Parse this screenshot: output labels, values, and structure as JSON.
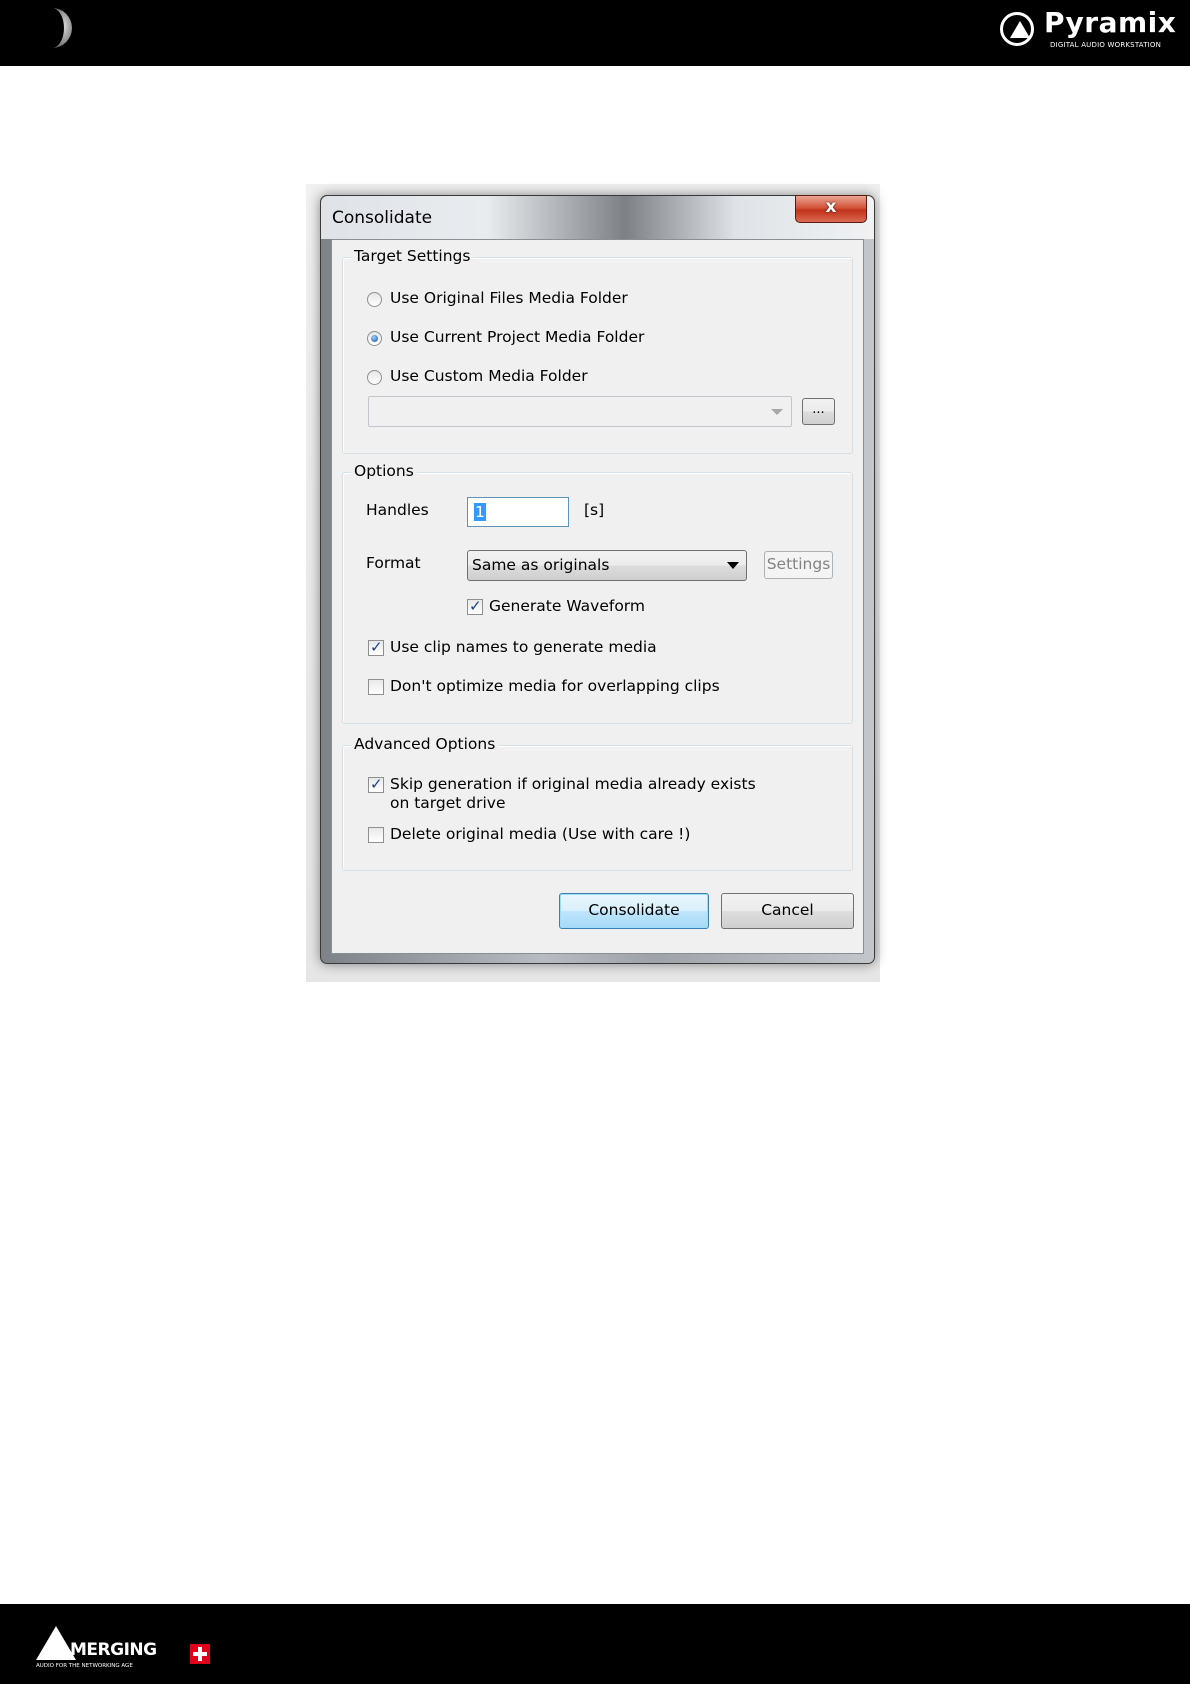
{
  "header": {
    "brand_name": "Pyramix",
    "brand_subtitle": "DIGITAL AUDIO WORKSTATION"
  },
  "footer": {
    "brand_name": "MERGING",
    "brand_subtitle": "AUDIO FOR THE NETWORKING AGE"
  },
  "dialog": {
    "title": "Consolidate",
    "close_label": "x",
    "target_settings": {
      "legend": "Target Settings",
      "options": [
        {
          "label": "Use Original Files Media Folder",
          "selected": false
        },
        {
          "label": "Use Current Project Media Folder",
          "selected": true
        },
        {
          "label": "Use Custom Media Folder",
          "selected": false
        }
      ],
      "custom_folder_value": "",
      "browse_label": "..."
    },
    "options": {
      "legend": "Options",
      "handles_label": "Handles",
      "handles_value": "1",
      "handles_unit": "[s]",
      "format_label": "Format",
      "format_value": "Same as originals",
      "settings_label": "Settings",
      "generate_waveform_label": "Generate Waveform",
      "generate_waveform_checked": true,
      "use_clip_names_label": "Use clip names to generate media",
      "use_clip_names_checked": true,
      "dont_optimize_label": "Don't optimize media for overlapping clips",
      "dont_optimize_checked": false
    },
    "advanced": {
      "legend": "Advanced Options",
      "skip_generation_line1": "Skip generation if original media already exists",
      "skip_generation_line2": "on target drive",
      "skip_generation_checked": true,
      "delete_original_label": "Delete original media (Use with care !)",
      "delete_original_checked": false
    },
    "buttons": {
      "consolidate": "Consolidate",
      "cancel": "Cancel"
    }
  }
}
